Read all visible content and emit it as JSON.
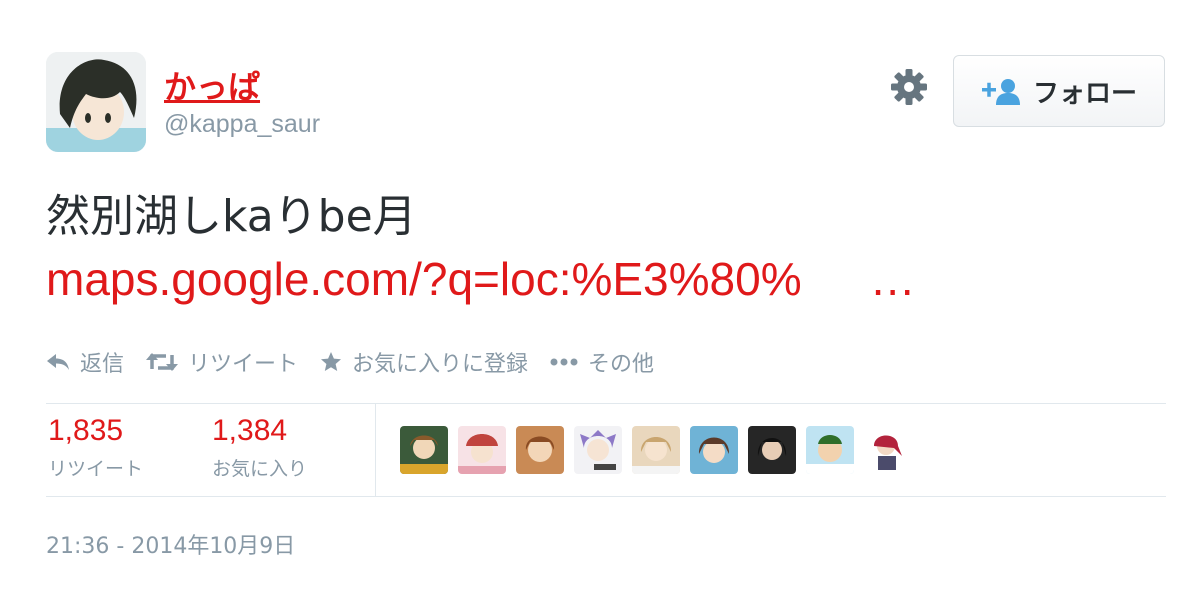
{
  "user": {
    "display_name": "かっぱ",
    "handle": "@kappa_saur"
  },
  "follow_button": {
    "label": "フォロー",
    "icon": "add-user-icon"
  },
  "settings_icon": "gear-icon",
  "tweet": {
    "text": "然別湖しkaりbe月",
    "link": "maps.google.com/?q=loc:%E3%80%",
    "link_ellipsis": "…"
  },
  "actions": [
    {
      "label": "返信",
      "icon": "reply-icon"
    },
    {
      "label": "リツイート",
      "icon": "retweet-icon"
    },
    {
      "label": "お気に入りに登録",
      "icon": "star-icon"
    },
    {
      "label": "その他",
      "icon": "more-dots-icon"
    }
  ],
  "stats": {
    "retweets": {
      "value": "1,835",
      "label": "リツイート"
    },
    "favorites": {
      "value": "1,384",
      "label": "お気に入り"
    }
  },
  "timestamp": "21:36 - 2014年10月9日",
  "colors": {
    "accent": "#e0191a",
    "muted": "#8899a6",
    "text": "#292f33",
    "divider": "#e1e8ed"
  }
}
